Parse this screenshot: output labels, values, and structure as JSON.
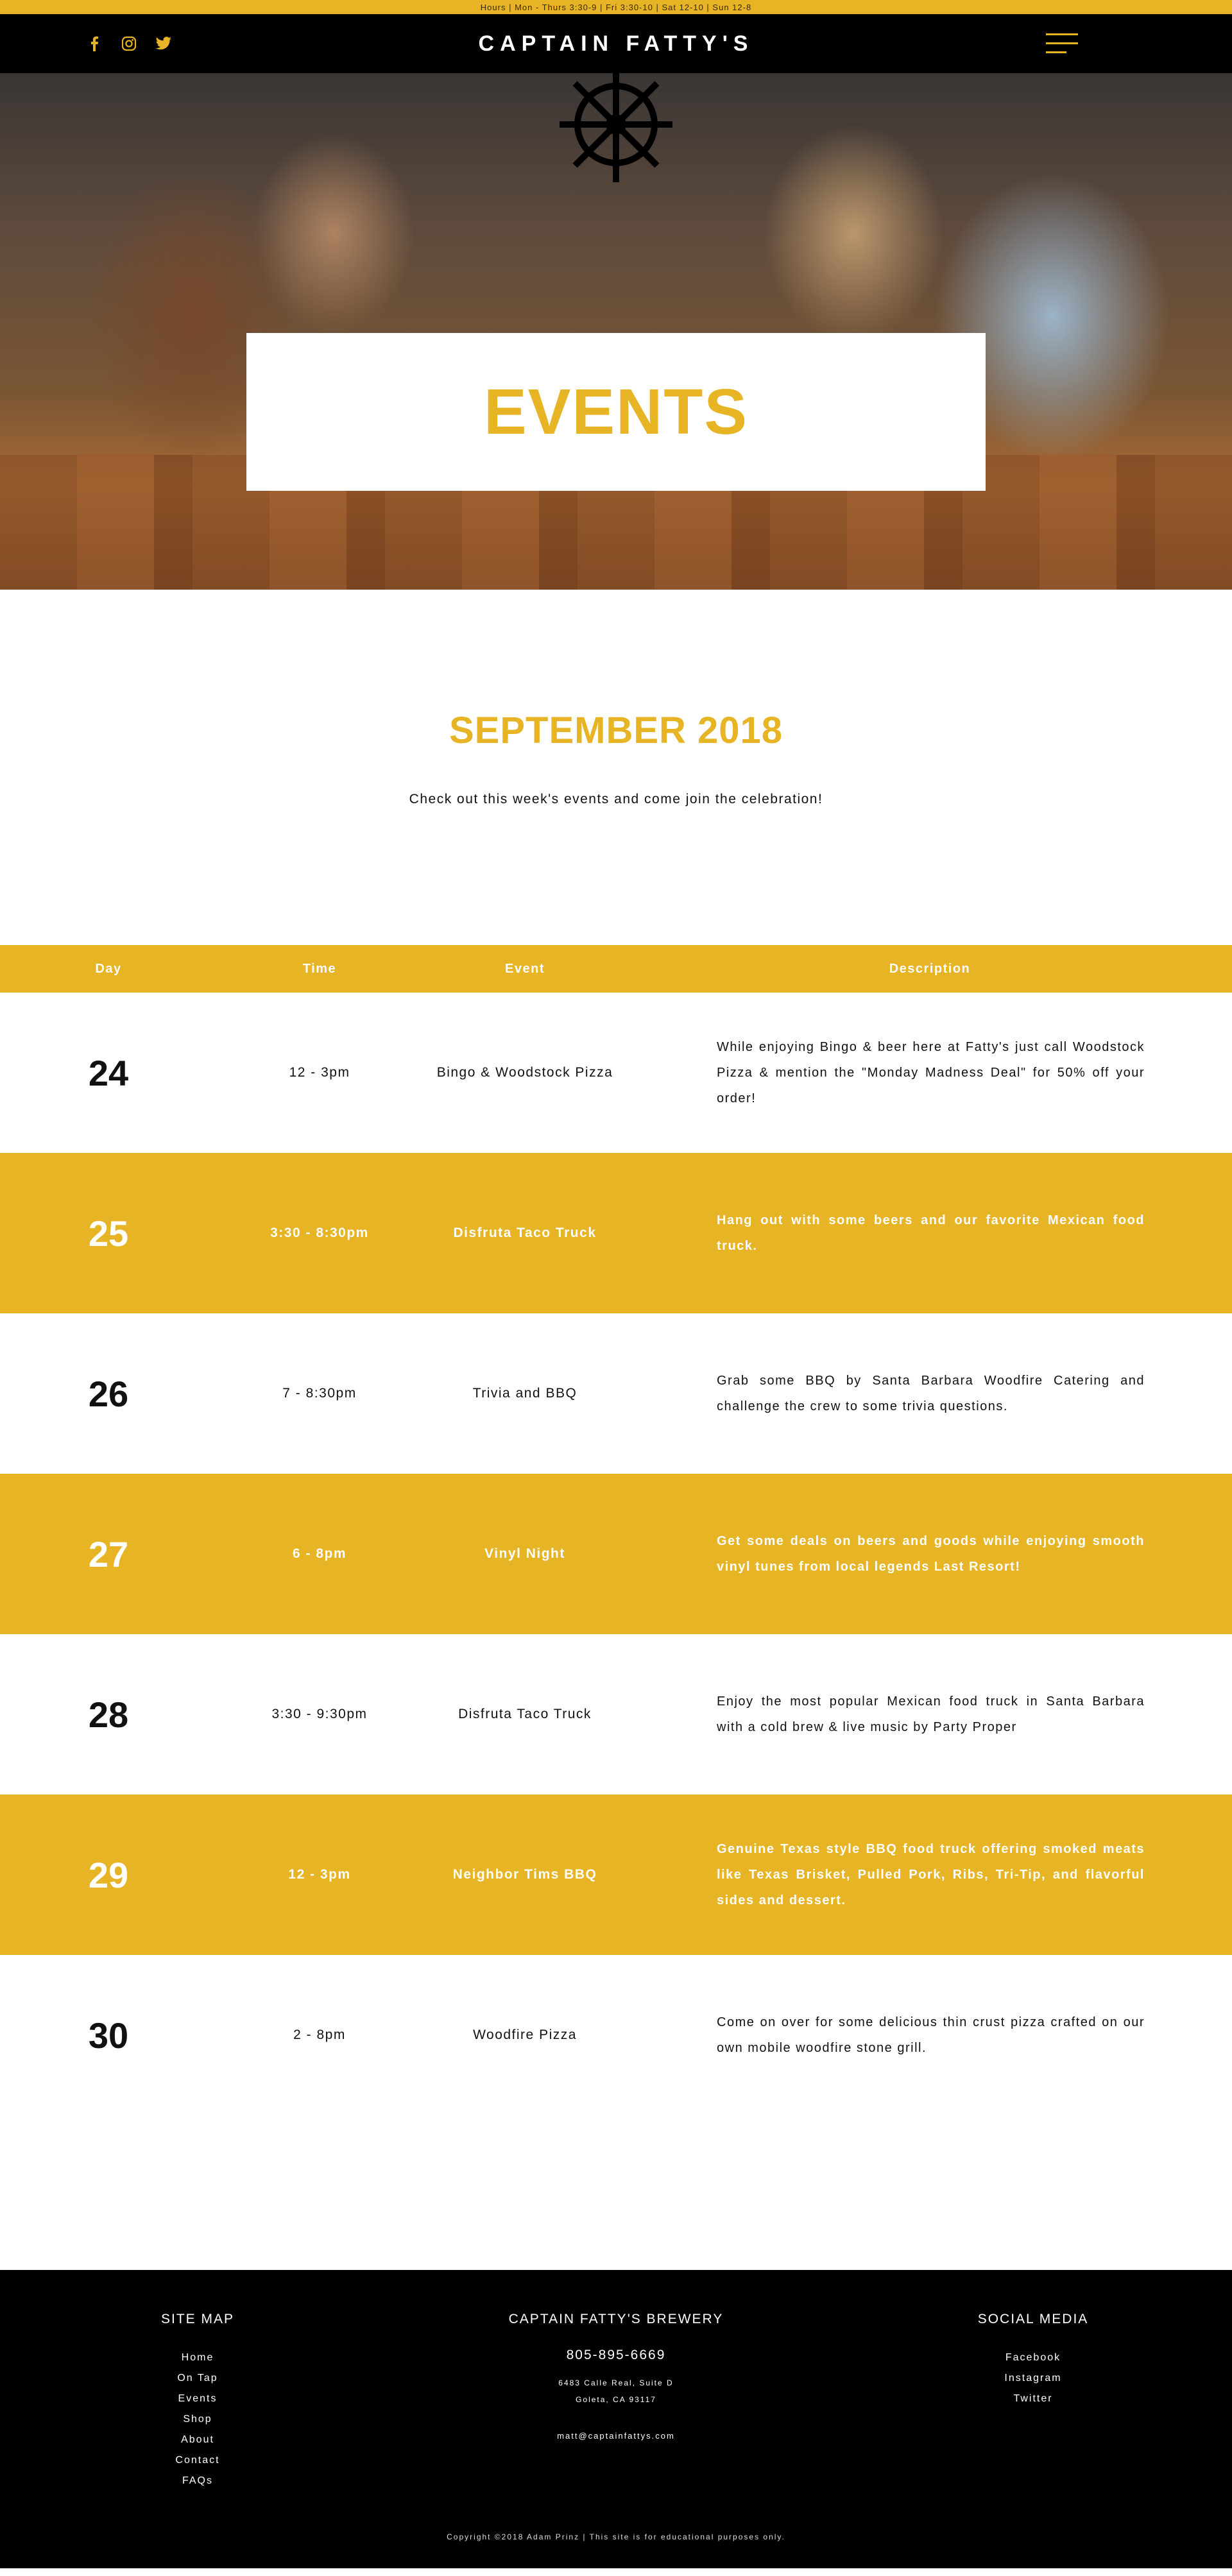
{
  "topbar": {
    "hours": "Hours | Mon - Thurs 3:30-9 | Fri 3:30-10 | Sat 12-10 | Sun 12-8"
  },
  "nav": {
    "brand": "CAPTAIN FATTY'S",
    "social_icons": [
      "facebook-icon",
      "instagram-icon",
      "twitter-icon"
    ],
    "menu_icon": "hamburger-menu-icon"
  },
  "hero": {
    "title": "EVENTS"
  },
  "intro": {
    "month": "SEPTEMBER 2018",
    "subtitle": "Check out this week's events and come join the celebration!"
  },
  "table": {
    "headers": {
      "day": "Day",
      "time": "Time",
      "event": "Event",
      "description": "Description"
    },
    "rows": [
      {
        "day": "24",
        "time": "12 - 3pm",
        "event": "Bingo & Woodstock Pizza",
        "description": "While enjoying Bingo & beer here at Fatty's just call Woodstock Pizza & mention the \"Monday Madness Deal\" for 50% off your order!"
      },
      {
        "day": "25",
        "time": "3:30 - 8:30pm",
        "event": "Disfruta Taco Truck",
        "description": "Hang out with some beers and our favorite Mexican food truck."
      },
      {
        "day": "26",
        "time": "7 - 8:30pm",
        "event": "Trivia and BBQ",
        "description": "Grab some BBQ by Santa Barbara Woodfire Catering and challenge the crew to some trivia questions."
      },
      {
        "day": "27",
        "time": "6 - 8pm",
        "event": "Vinyl Night",
        "description": "Get some deals on beers and goods while enjoying smooth vinyl tunes from local legends Last Resort!"
      },
      {
        "day": "28",
        "time": "3:30 - 9:30pm",
        "event": "Disfruta Taco Truck",
        "description": "Enjoy the most popular Mexican food truck in Santa Barbara with a cold brew & live music by Party Proper"
      },
      {
        "day": "29",
        "time": "12 - 3pm",
        "event": "Neighbor Tims BBQ",
        "description": "Genuine Texas style BBQ food truck offering smoked meats like Texas Brisket, Pulled Pork, Ribs, Tri-Tip, and flavorful sides and dessert."
      },
      {
        "day": "30",
        "time": "2 - 8pm",
        "event": "Woodfire Pizza",
        "description": "Come on over for some delicious thin crust pizza crafted on our own mobile woodfire stone grill."
      }
    ]
  },
  "footer": {
    "sitemap": {
      "title": "SITE MAP",
      "links": [
        "Home",
        "On Tap",
        "Events",
        "Shop",
        "About",
        "Contact",
        "FAQs"
      ]
    },
    "brewery": {
      "title": "CAPTAIN FATTY'S BREWERY",
      "phone": "805-895-6669",
      "address_line1": "6483 Calle Real, Suite D",
      "address_line2": "Goleta, CA 93117",
      "email": "matt@captainfattys.com"
    },
    "social": {
      "title": "SOCIAL MEDIA",
      "links": [
        "Facebook",
        "Instagram",
        "Twitter"
      ]
    },
    "copyright": "Copyright ©2018 Adam Prinz | This site is for educational purposes only."
  },
  "colors": {
    "accent": "#e7b425",
    "dark": "#000000",
    "light": "#ffffff"
  }
}
